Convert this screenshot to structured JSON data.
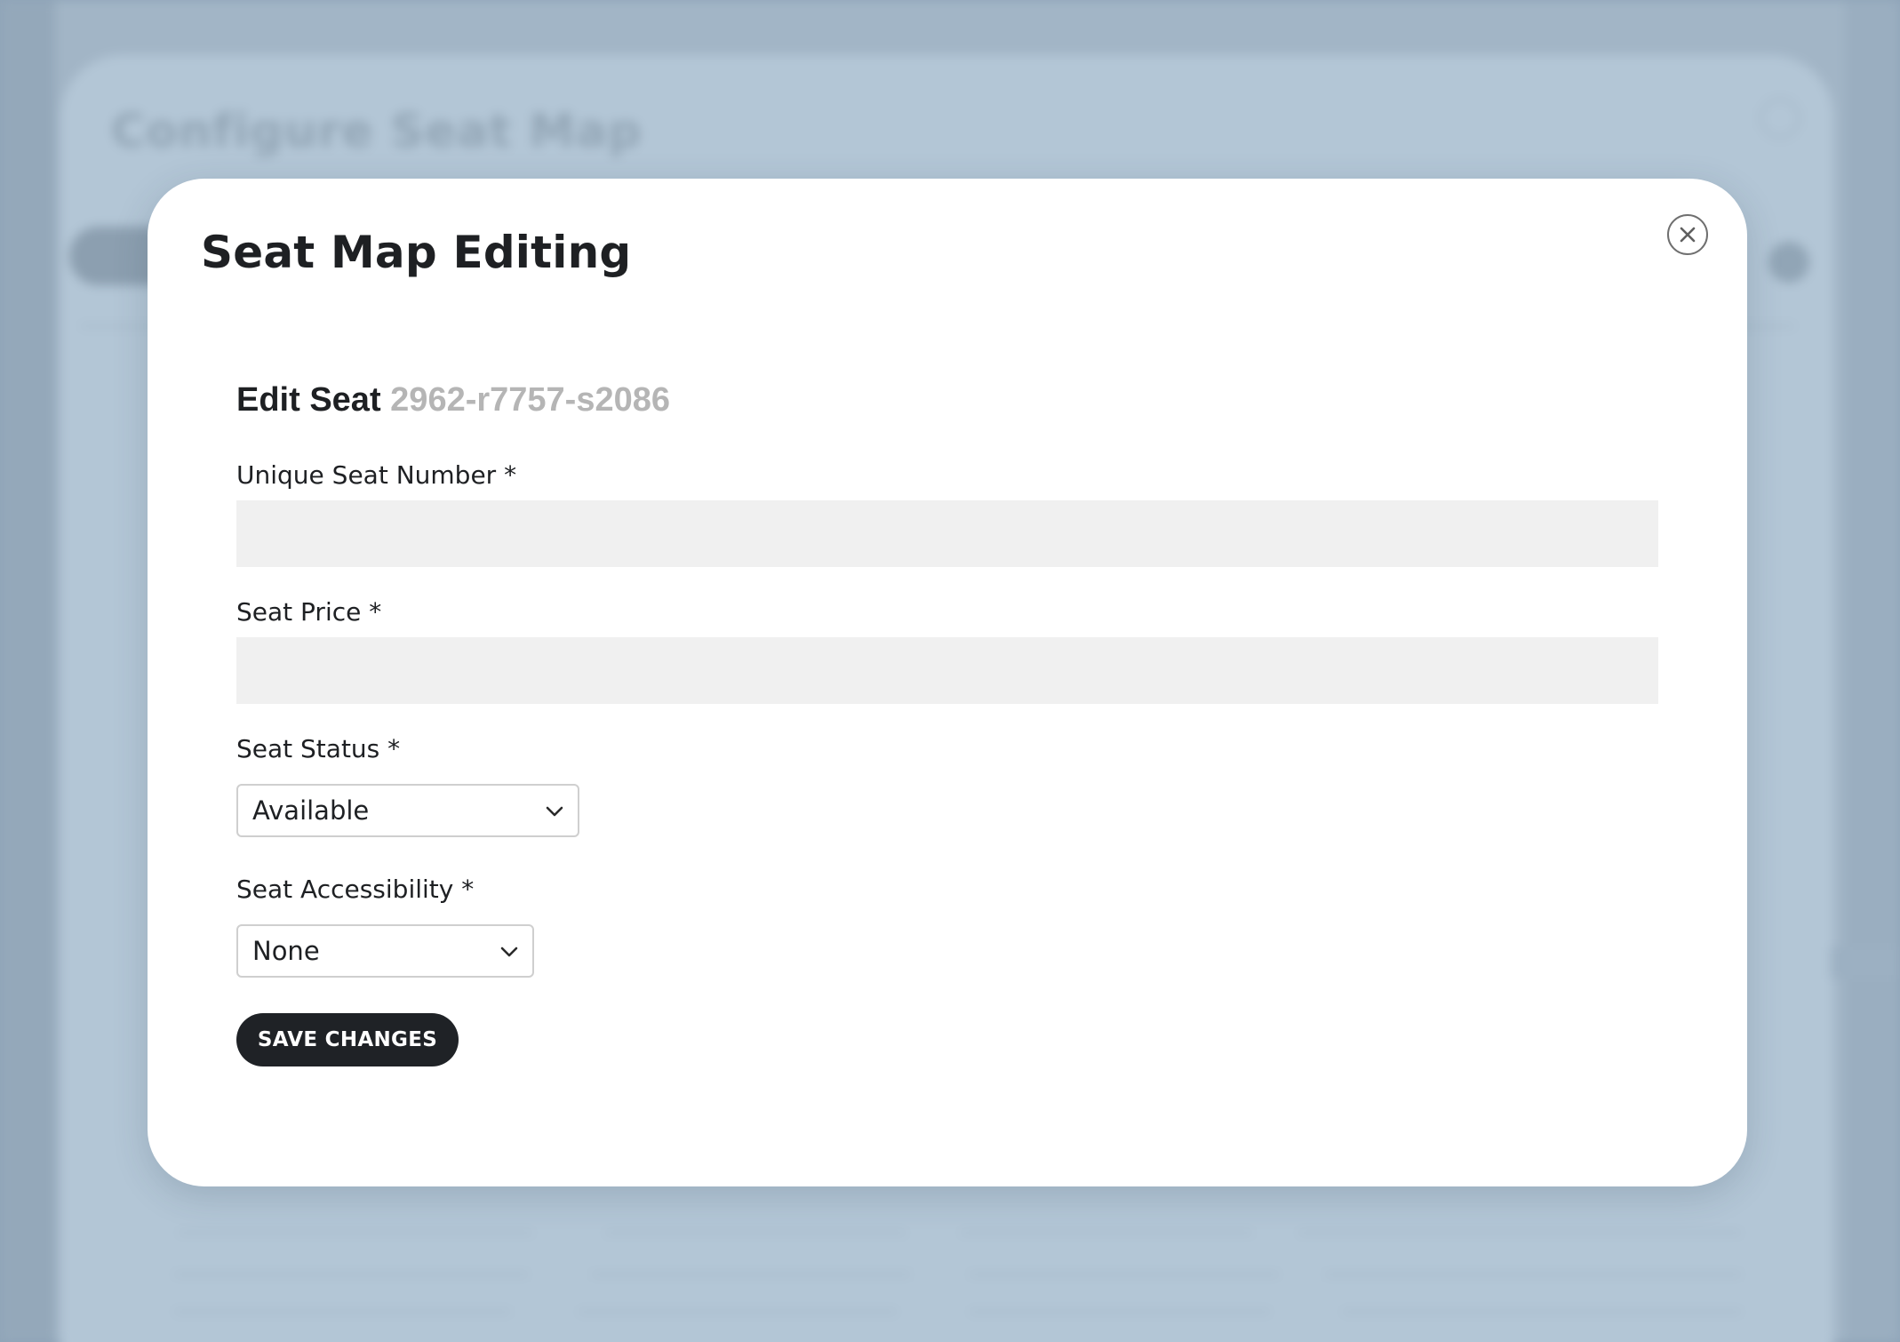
{
  "background": {
    "title": "Configure Seat Map"
  },
  "modal": {
    "title": "Seat Map Editing",
    "close_icon": "close-icon"
  },
  "form": {
    "heading": "Edit Seat",
    "seat_id": "2962-r7757-s2086",
    "seat_number": {
      "label": "Unique Seat Number *",
      "value": ""
    },
    "seat_price": {
      "label": "Seat Price *",
      "value": ""
    },
    "seat_status": {
      "label": "Seat Status *",
      "selected": "Available"
    },
    "seat_accessibility": {
      "label": "Seat Accessibility *",
      "selected": "None"
    },
    "save_label": "SAVE CHANGES"
  },
  "colors": {
    "backdrop": "#a2b5c6",
    "modal": "#ffffff",
    "primary_button": "#1f2226",
    "input_fill": "#f0f0f0",
    "seat_id_text": "#b5b5b5"
  }
}
